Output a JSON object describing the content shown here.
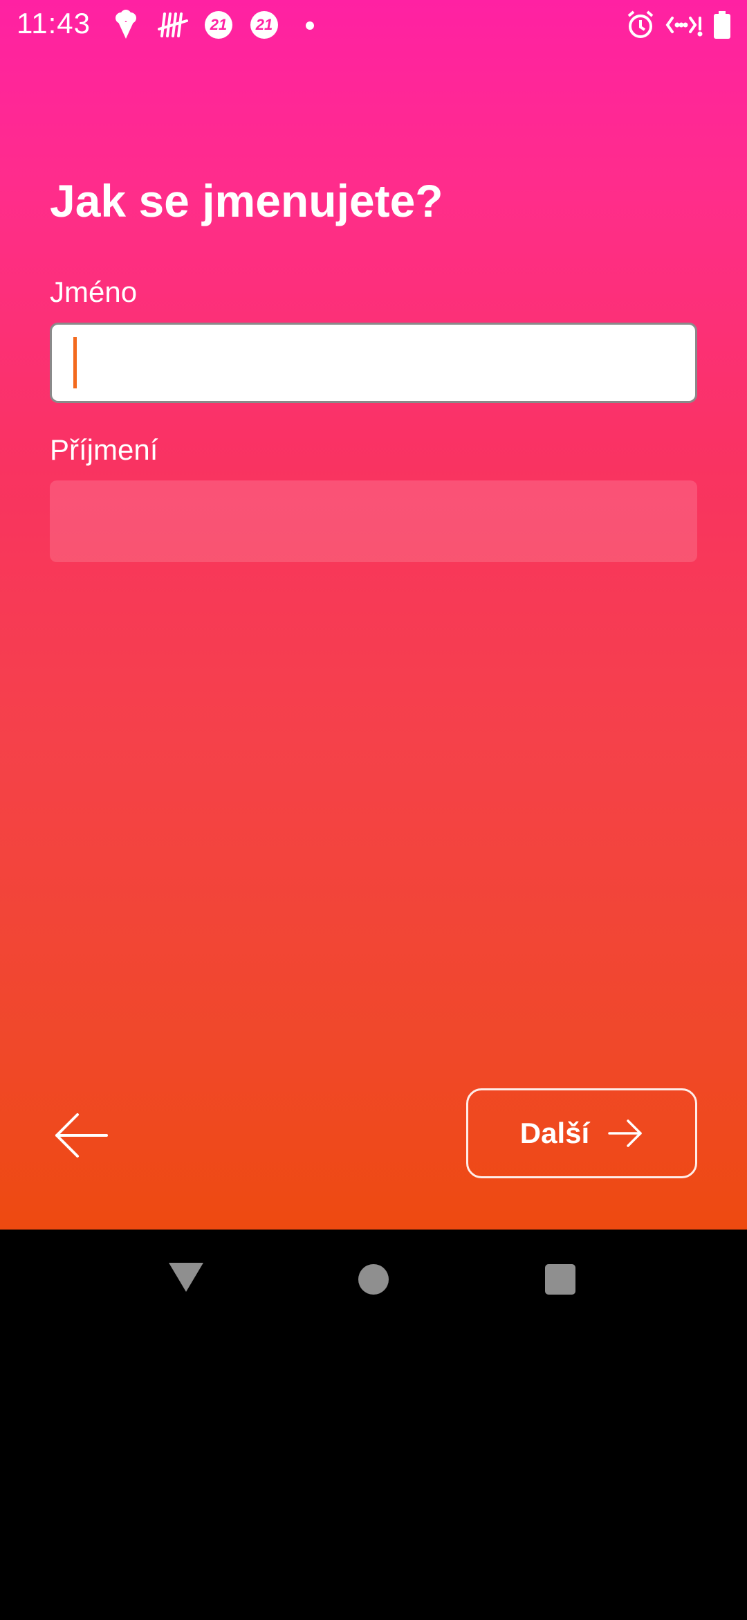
{
  "status_bar": {
    "time": "11:43",
    "badge_1": "21",
    "badge_2": "21",
    "icons": [
      "ice-cream-icon",
      "tally-icon",
      "badge-21-icon",
      "badge-21-icon",
      "dot-icon",
      "alarm-icon",
      "wifi-calling-icon",
      "battery-icon"
    ]
  },
  "form": {
    "title": "Jak se jmenujete?",
    "first_name_label": "Jméno",
    "first_name_value": "",
    "last_name_label": "Příjmení",
    "last_name_value": ""
  },
  "actions": {
    "back_icon": "arrow-left-icon",
    "next_label": "Další",
    "next_icon": "arrow-right-icon"
  },
  "colors": {
    "gradient_top": "#ff21a3",
    "gradient_bottom": "#ee4a10",
    "caret": "#f36a1e"
  },
  "nav_bar": {
    "buttons": [
      "nav-back",
      "nav-home",
      "nav-recents"
    ]
  }
}
